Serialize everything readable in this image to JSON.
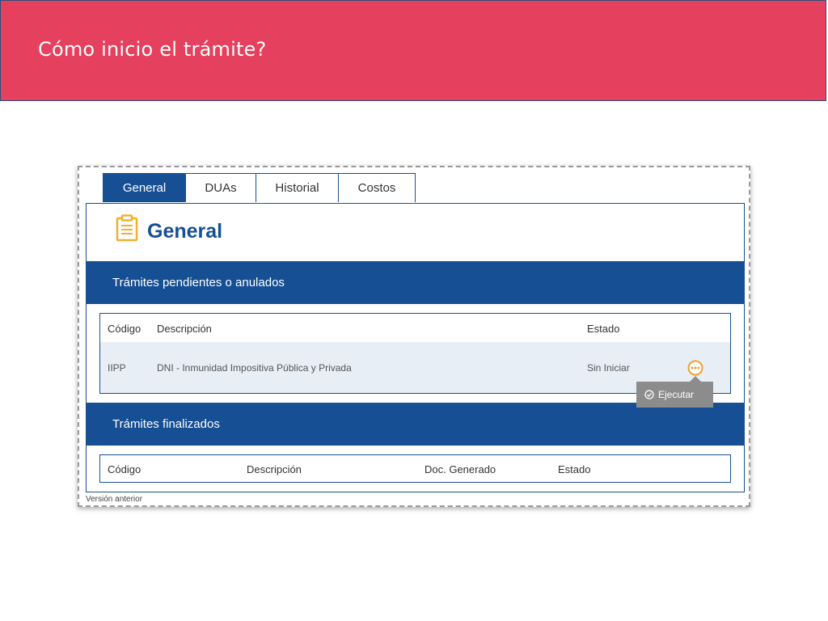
{
  "slide": {
    "title": "Cómo inicio el trámite?",
    "header_color": "#e5405d"
  },
  "tabs": [
    {
      "label": "General",
      "active": true
    },
    {
      "label": "DUAs",
      "active": false
    },
    {
      "label": "Historial",
      "active": false
    },
    {
      "label": "Costos",
      "active": false
    }
  ],
  "panel": {
    "title": "General",
    "icon": "clipboard-icon",
    "accent_color": "#164f94",
    "icon_color": "#f0b030"
  },
  "pending": {
    "section_title": "Trámites pendientes o anulados",
    "columns": [
      "Código",
      "Descripción",
      "Estado"
    ],
    "rows": [
      {
        "codigo": "IIPP",
        "descripcion": "DNI - Inmunidad Impositiva Pública y Privada",
        "estado": "Sin Iniciar"
      }
    ],
    "action_icon": "more-options-icon"
  },
  "tooltip": {
    "label": "Ejecutar",
    "icon": "check-circle-icon"
  },
  "finished": {
    "section_title": "Trámites finalizados",
    "columns": [
      "Código",
      "Descripción",
      "Doc. Generado",
      "Estado"
    ]
  },
  "footer": {
    "version_link": "Versión anterior"
  }
}
